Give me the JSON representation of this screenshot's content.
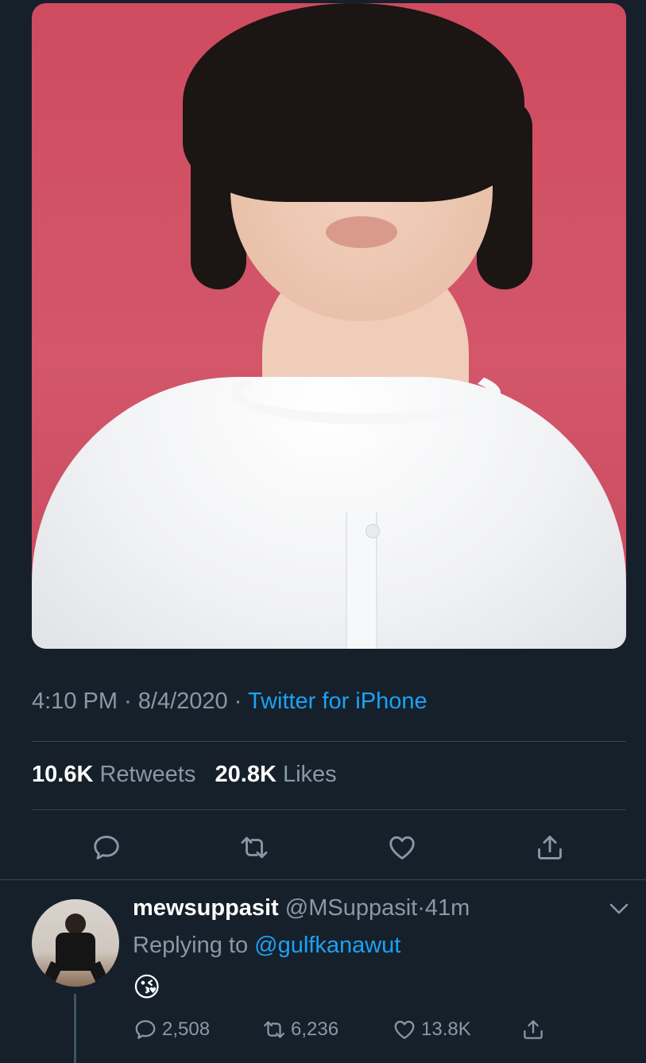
{
  "tweet": {
    "time": "4:10 PM",
    "date": "8/4/2020",
    "source": "Twitter for iPhone",
    "retweets_count": "10.6K",
    "retweets_label": "Retweets",
    "likes_count": "20.8K",
    "likes_label": "Likes"
  },
  "reply": {
    "name": "mewsuppasit",
    "handle": "@MSuppasit",
    "time": "41m",
    "replying_label": "Replying to",
    "replying_to": "@gulfkanawut",
    "text": "😘",
    "reply_count": "2,508",
    "retweet_count": "6,236",
    "like_count": "13.8K"
  },
  "colors": {
    "background": "#15202b",
    "accent": "#1da1f2",
    "muted": "#8899a6",
    "divider": "#38444d"
  },
  "icons": [
    "reply-icon",
    "retweet-icon",
    "like-icon",
    "share-icon",
    "chevron-down-icon"
  ]
}
